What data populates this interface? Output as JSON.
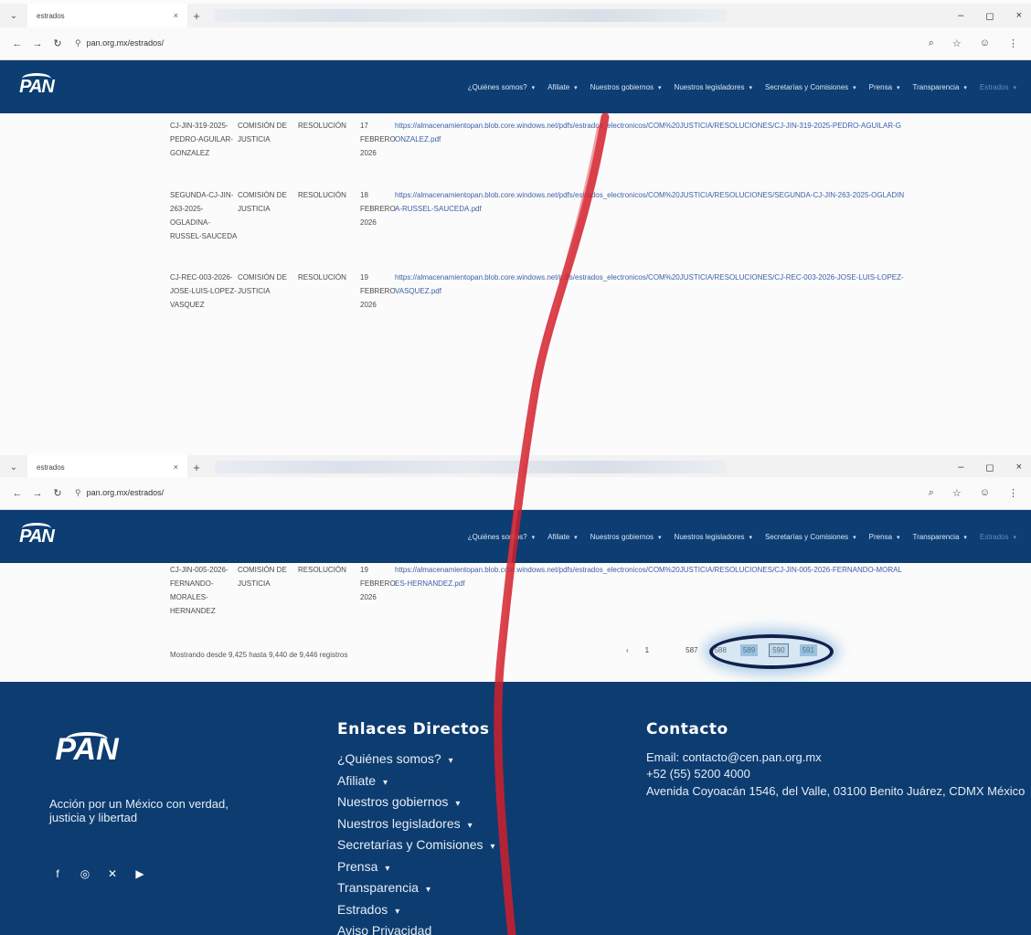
{
  "tabbar": {
    "tab_title": "estrados",
    "close_glyph": "×",
    "new_tab_glyph": "+",
    "window": {
      "minimize": "–",
      "maximize": "◻",
      "close": "×"
    }
  },
  "address": {
    "url": "pan.org.mx/estrados/"
  },
  "nav": {
    "items": [
      "¿Quiénes somos?",
      "Afiliate",
      "Nuestros gobiernos",
      "Nuestros legisladores",
      "Secretarías y Comisiones",
      "Prensa",
      "Transparencia",
      "Estrados"
    ]
  },
  "logo_text": "PAN",
  "rows_top": [
    {
      "expediente": "CJ-JIN-319-2025-PEDRO-AGUILAR-GONZALEZ",
      "organo": "COMISIÓN DE JUSTICIA",
      "tipo": "RESOLUCIÓN",
      "fecha": "17 FEBRERO 2026",
      "url": "https://almacenamientopan.blob.core.windows.net/pdfs/estrados_electronicos/COM%20JUSTICIA/RESOLUCIONES/CJ-JIN-319-2025-PEDRO-AGUILAR-GONZALEZ.pdf"
    },
    {
      "expediente": "SEGUNDA-CJ-JIN-263-2025-OGLADINA-RUSSEL-SAUCEDA",
      "organo": "COMISIÓN DE JUSTICIA",
      "tipo": "RESOLUCIÓN",
      "fecha": "18 FEBRERO 2026",
      "url": "https://almacenamientopan.blob.core.windows.net/pdfs/estrados_electronicos/COM%20JUSTICIA/RESOLUCIONES/SEGUNDA-CJ-JIN-263-2025-OGLADINA-RUSSEL-SAUCEDA.pdf"
    },
    {
      "expediente": "CJ-REC-003-2026-JOSE-LUIS-LOPEZ-VASQUEZ",
      "organo": "COMISIÓN DE JUSTICIA",
      "tipo": "RESOLUCIÓN",
      "fecha": "19 FEBRERO 2026",
      "url": "https://almacenamientopan.blob.core.windows.net/pdfs/estrados_electronicos/COM%20JUSTICIA/RESOLUCIONES/CJ-REC-003-2026-JOSE-LUIS-LOPEZ-VASQUEZ.pdf"
    }
  ],
  "rows_bottom": [
    {
      "expediente": "CJ-JIN-005-2026-FERNANDO-MORALES-HERNANDEZ",
      "organo": "COMISIÓN DE JUSTICIA",
      "tipo": "RESOLUCIÓN",
      "fecha": "19 FEBRERO 2026",
      "url": "https://almacenamientopan.blob.core.windows.net/pdfs/estrados_electronicos/COM%20JUSTICIA/RESOLUCIONES/CJ-JIN-005-2026-FERNANDO-MORALES-HERNANDEZ.pdf"
    }
  ],
  "pagination": {
    "summary": "Mostrando desde 9,425 hasta 9,440 de 9,446 registros",
    "prev": "‹",
    "first": "1",
    "p587": "587",
    "p588": "588",
    "p589": "589",
    "p590": "590",
    "p591": "591",
    "next": "›"
  },
  "footer": {
    "logo_text": "PAN",
    "tagline": "Acción por un México con verdad, justicia y libertad",
    "links_title": "Enlaces Directos",
    "links": [
      "¿Quiénes somos?",
      "Afiliate",
      "Nuestros gobiernos",
      "Nuestros legisladores",
      "Secretarías y Comisiones",
      "Prensa",
      "Transparencia",
      "Estrados",
      "Aviso Privacidad"
    ],
    "contact_title": "Contacto",
    "email": "Email: contacto@cen.pan.org.mx",
    "phone": "+52 (55) 5200 4000",
    "address": "Avenida Coyoacán 1546, del Valle, 03100 Benito Juárez, CDMX México"
  },
  "colors": {
    "header_bg": "#0c3d73",
    "footer_bg": "#0d3c70",
    "link": "#3d5fa8",
    "annotation_red": "#d21f2a"
  }
}
